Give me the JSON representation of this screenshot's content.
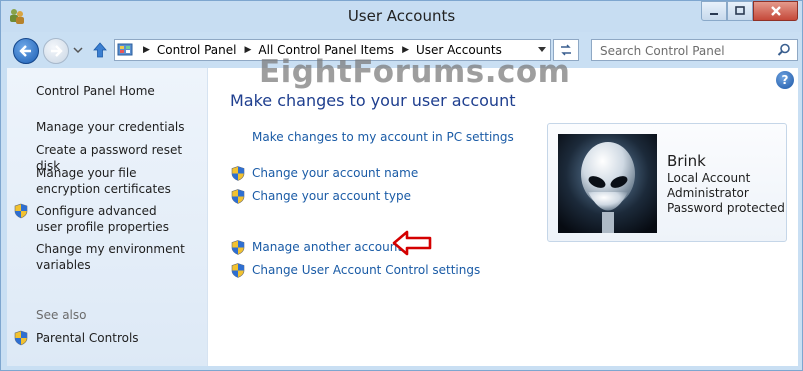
{
  "window": {
    "title": "User Accounts",
    "watermark": "EightForums.com"
  },
  "address_bar": {
    "crumbs": [
      "Control Panel",
      "All Control Panel Items",
      "User Accounts"
    ]
  },
  "search": {
    "placeholder": "Search Control Panel"
  },
  "left_pane": {
    "home": "Control Panel Home",
    "items": [
      {
        "label": "Manage your credentials"
      },
      {
        "label": "Create a password reset disk"
      },
      {
        "label": "Manage your file encryption certificates"
      },
      {
        "label": "Configure advanced user profile properties"
      },
      {
        "label": "Change my environment variables"
      }
    ],
    "see_also_label": "See also",
    "see_also_items": [
      {
        "label": "Parental Controls"
      }
    ]
  },
  "main": {
    "title": "Make changes to your user account",
    "links": {
      "pc_settings": "Make changes to my account in PC settings",
      "change_name": "Change your account name",
      "change_type": "Change your account type",
      "manage_another": "Manage another account",
      "uac_settings": "Change User Account Control settings"
    }
  },
  "user_card": {
    "name": "Brink",
    "account_kind": "Local Account",
    "role": "Administrator",
    "password_state": "Password protected"
  },
  "colors": {
    "link": "#1a5ba6",
    "title": "#1f3f8f",
    "arrow": "#d40000"
  },
  "icons": {
    "title": "users-icon",
    "back": "back-arrow-icon",
    "forward": "forward-arrow-icon",
    "up": "up-arrow-icon",
    "refresh": "refresh-icon",
    "search": "search-icon",
    "help": "help-icon",
    "uac_shield": "uac-shield-icon",
    "avatar": "alien-avatar"
  }
}
